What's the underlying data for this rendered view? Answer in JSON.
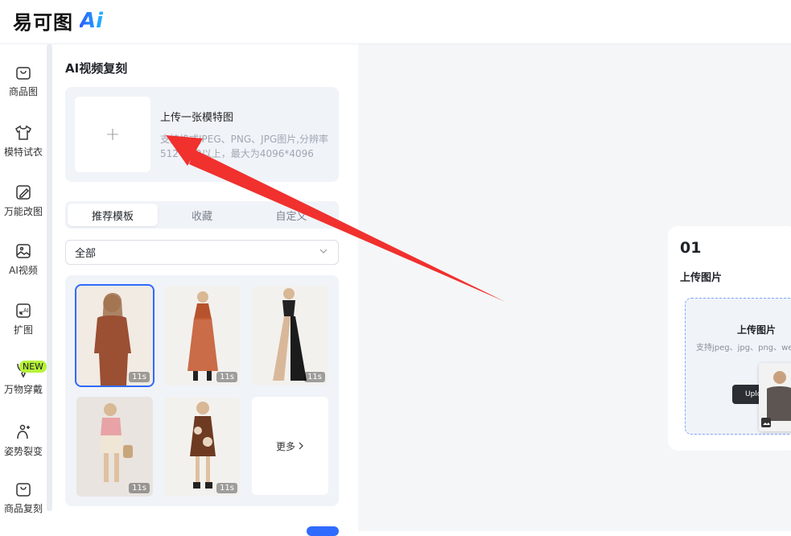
{
  "header": {
    "logo_text": "易可图",
    "logo_ai": "Ai"
  },
  "sidebar": {
    "items": [
      {
        "label": "商品图",
        "icon": "shopping-bag-icon"
      },
      {
        "label": "模特试衣",
        "icon": "tshirt-icon"
      },
      {
        "label": "万能改图",
        "icon": "image-edit-icon"
      },
      {
        "label": "AI视频",
        "icon": "video-image-icon"
      },
      {
        "label": "扩图",
        "icon": "expand-image-icon"
      },
      {
        "label": "万物穿戴",
        "icon": "necklace-icon"
      },
      {
        "label": "姿势裂变",
        "icon": "pose-person-icon"
      },
      {
        "label": "商品复刻",
        "icon": "bag-copy-icon"
      }
    ],
    "new_badge": "NEW"
  },
  "panel": {
    "title": "AI视频复刻",
    "upload": {
      "plus": "+",
      "title": "上传一张模特图",
      "desc_line1": "支持格式JPEG、PNG、JPG图片,分辨率",
      "desc_line2": "512*512以上，最大为4096*4096"
    },
    "tabs": [
      "推荐模板",
      "收藏",
      "自定义"
    ],
    "select_value": "全部",
    "templates": [
      {
        "duration": "11s",
        "selected": true
      },
      {
        "duration": "11s",
        "selected": false
      },
      {
        "duration": "11s",
        "selected": false
      },
      {
        "duration": "11s",
        "selected": false
      },
      {
        "duration": "11s",
        "selected": false
      }
    ],
    "more_label": "更多"
  },
  "canvas": {
    "step_num": "01",
    "step_title": "上传图片",
    "dropzone_title": "上传图片",
    "dropzone_desc": "支持jpeg、jpg、png、we",
    "upload_button": "Uplo"
  },
  "colors": {
    "accent": "#2f6bff",
    "arrow": "#f0312e",
    "badge": "#b6f33a"
  }
}
